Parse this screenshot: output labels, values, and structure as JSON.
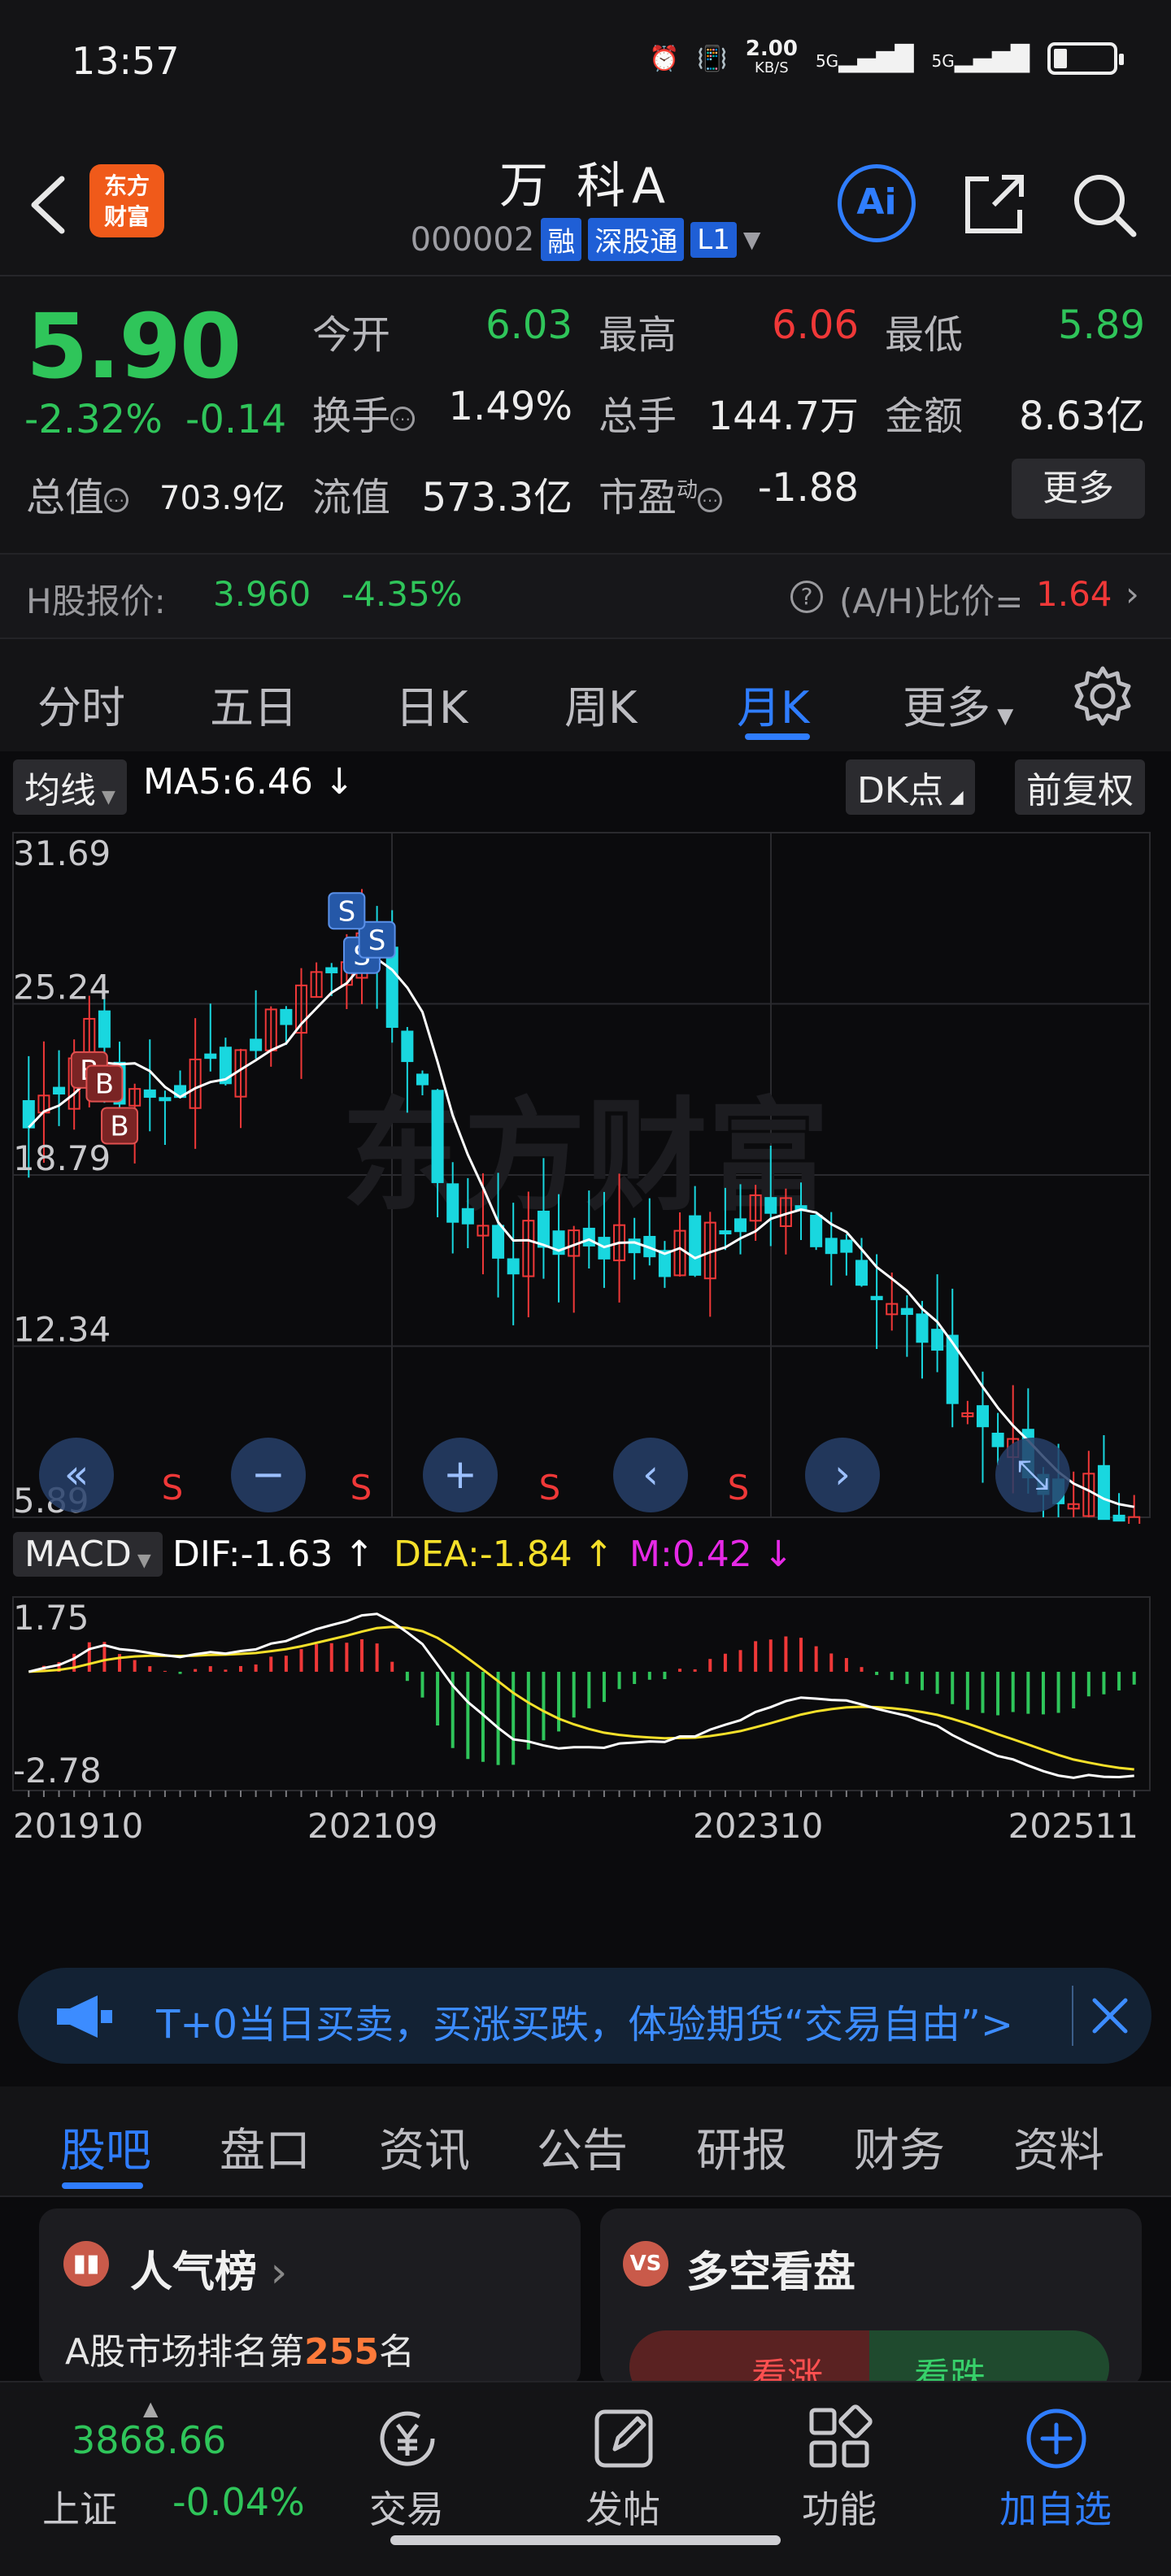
{
  "status_bar": {
    "time": "13:57",
    "net_speed": "2.00",
    "net_unit": "KB/S",
    "signal1": "5G",
    "signal2": "5G"
  },
  "header": {
    "brand_line1": "东方",
    "brand_line2": "财富",
    "stock_name": "万 科A",
    "stock_code": "000002",
    "tags": [
      "融",
      "深股通",
      "L1"
    ],
    "ai_label": "Ai"
  },
  "quote": {
    "price": "5.90",
    "change_pct": "-2.32%",
    "change_abs": "-0.14",
    "open_label": "今开",
    "open": "6.03",
    "high_label": "最高",
    "high": "6.06",
    "low_label": "最低",
    "low": "5.89",
    "turnover_label": "换手",
    "turnover": "1.49%",
    "volume_label": "总手",
    "volume": "144.7万",
    "amount_label": "金额",
    "amount": "8.63亿",
    "mcap_label": "总值",
    "mcap": "703.9亿",
    "float_label": "流值",
    "float": "573.3亿",
    "pe_label": "市盈",
    "pe_sup": "动",
    "pe": "-1.88",
    "more_label": "更多"
  },
  "hshare": {
    "label": "H股报价:",
    "price": "3.960",
    "change": "-4.35%",
    "ratio_label": "(A/H)比价=",
    "ratio": "1.64"
  },
  "period_tabs": [
    "分时",
    "五日",
    "日K",
    "周K",
    "月K",
    "更多"
  ],
  "chart_toolbar": {
    "ma_selector": "均线",
    "ma5_text": "MA5:6.46",
    "dk_label": "DK点",
    "fq_label": "前复权"
  },
  "macd_toolbar": {
    "selector": "MACD",
    "dif": "DIF:-1.63",
    "dea": "DEA:-1.84",
    "m": "M:0.42"
  },
  "chart_data": [
    {
      "type": "candlestick",
      "title": "月K",
      "y_tick_labels": [
        "31.69",
        "25.24",
        "18.79",
        "12.34",
        "5.89"
      ],
      "ylim": [
        5.89,
        31.69
      ],
      "x_tick_labels": [
        "201910",
        "202109",
        "202310",
        "202511"
      ],
      "last_close": 5.9,
      "ma5": 6.46,
      "signals": [
        "B",
        "B",
        "B",
        "S",
        "S",
        "S"
      ],
      "bottom_markers": [
        "S",
        "S",
        "S",
        "S"
      ],
      "colors": {
        "up": "#f03838",
        "down": "#19d7df",
        "ma5": "#ffffff"
      }
    },
    {
      "type": "macd",
      "y_tick_labels": [
        "1.75",
        "-2.78"
      ],
      "ylim": [
        -2.78,
        1.75
      ],
      "dif": -1.63,
      "dea": -1.84,
      "m": 0.42,
      "colors": {
        "dif": "#ffffff",
        "dea": "#f5e02a",
        "positive": "#f03838",
        "negative": "#2fc55a"
      }
    }
  ],
  "banner": {
    "text": "T+0当日买卖，买涨买跌，体验期货“交易自由”>"
  },
  "sub_tabs": [
    "股吧",
    "盘口",
    "资讯",
    "公告",
    "研报",
    "财务",
    "资料"
  ],
  "cards": {
    "popularity": {
      "title": "人气榜",
      "text_prefix": "A股市场排名第",
      "rank": "255",
      "text_suffix": "名"
    },
    "longshort": {
      "title": "多空看盘",
      "bull": "看涨",
      "bear": "看跌"
    }
  },
  "bottom_nav": {
    "index_value": "3868.66",
    "index_name": "上证",
    "index_change": "-0.04%",
    "items": [
      "交易",
      "发帖",
      "功能",
      "加自选"
    ]
  }
}
